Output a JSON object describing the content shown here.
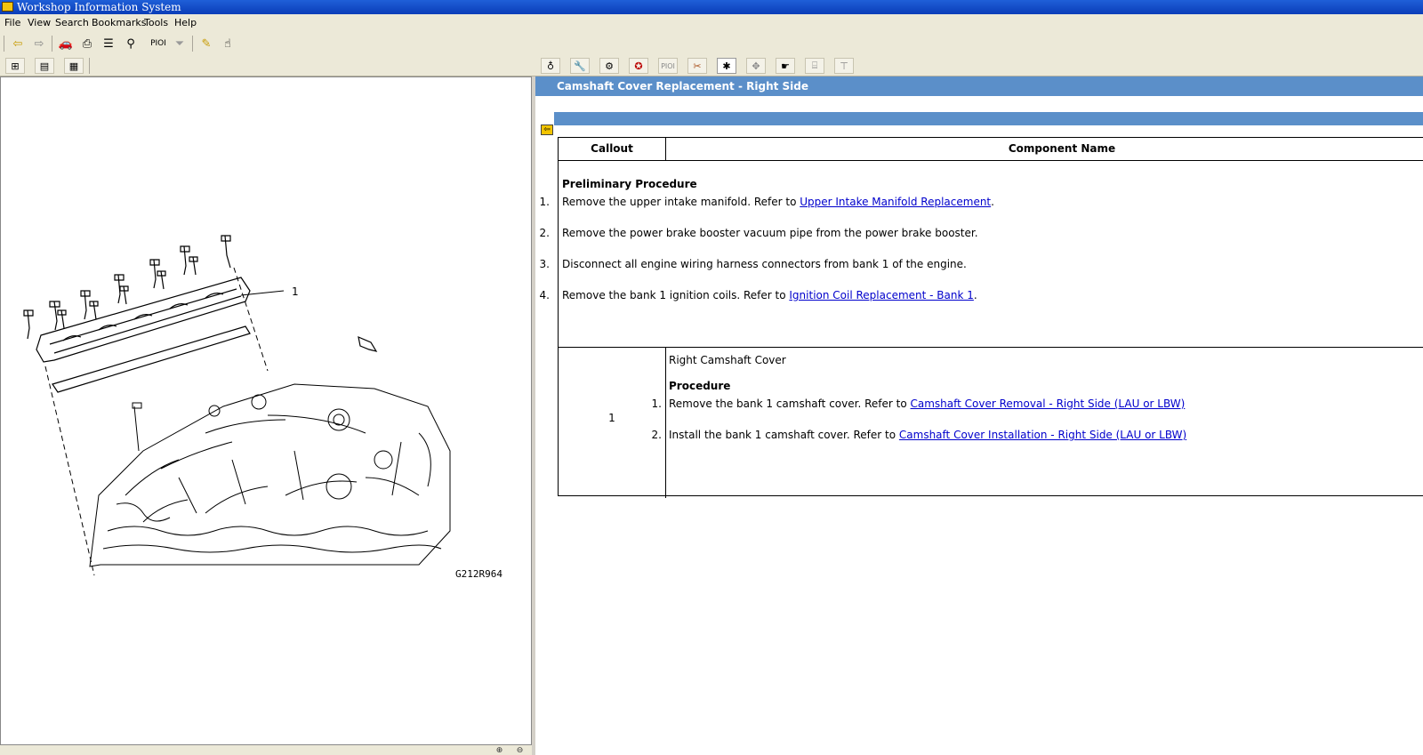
{
  "window": {
    "title": "Workshop Information System"
  },
  "menu": [
    "File",
    "View",
    "Search",
    "Bookmarks",
    "Tools",
    "Help"
  ],
  "toolbar": {
    "pioi_label": "PIOI"
  },
  "tabs_toolbar": {
    "pioi_label": "PIOI"
  },
  "diagram": {
    "callout_label": "1",
    "figure_id": "G212R964"
  },
  "document": {
    "title": "Camshaft Cover Replacement - Right Side",
    "table": {
      "headers": {
        "callout": "Callout",
        "component": "Component Name"
      },
      "preliminary": {
        "heading": "Preliminary Procedure",
        "steps": [
          {
            "num": "1.",
            "text": "Remove the upper intake manifold. Refer to ",
            "link": "Upper Intake Manifold Replacement",
            "after": "."
          },
          {
            "num": "2.",
            "text": "Remove the power brake booster vacuum pipe from the power brake booster.",
            "link": "",
            "after": ""
          },
          {
            "num": "3.",
            "text": "Disconnect all engine wiring harness connectors from bank 1 of the engine.",
            "link": "",
            "after": ""
          },
          {
            "num": "4.",
            "text": "Remove the bank 1 ignition coils. Refer to ",
            "link": "Ignition Coil Replacement - Bank 1",
            "after": "."
          }
        ]
      },
      "rows": [
        {
          "callout": "1",
          "component": "Right Camshaft Cover",
          "procedure_heading": "Procedure",
          "steps": [
            {
              "num": "1.",
              "text": "Remove the bank 1 camshaft cover. Refer to ",
              "link": "Camshaft Cover Removal - Right Side (LAU or LBW)"
            },
            {
              "num": "2.",
              "text": "Install the bank 1 camshaft cover. Refer to ",
              "link": "Camshaft Cover Installation - Right Side (LAU or LBW)"
            }
          ]
        }
      ]
    }
  },
  "colors": {
    "accent_bar": "#5b8fc9",
    "titlebar": "#0a3db8",
    "link": "#0000cc",
    "chrome": "#ece9d8"
  }
}
